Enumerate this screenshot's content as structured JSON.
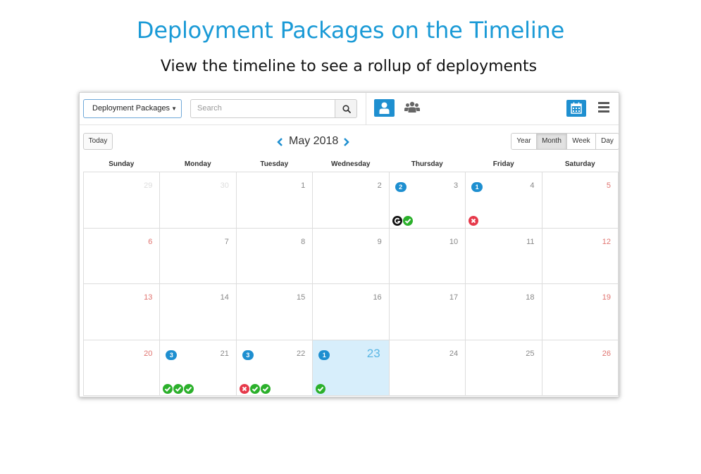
{
  "heading": {
    "title": "Deployment Packages on the Timeline",
    "subtitle": "View the timeline to see a rollup of deployments"
  },
  "toolbar": {
    "type_select": "Deployment Packages",
    "search_placeholder": "Search",
    "accent_color": "#1e8fd0"
  },
  "nav": {
    "today_label": "Today",
    "month_label": "May 2018",
    "views": [
      "Year",
      "Month",
      "Week",
      "Day"
    ],
    "active_view": "Month"
  },
  "calendar": {
    "weekdays": [
      "Sunday",
      "Monday",
      "Tuesday",
      "Wednesday",
      "Thursday",
      "Friday",
      "Saturday"
    ],
    "weeks": [
      [
        {
          "num": "29",
          "kind": "other"
        },
        {
          "num": "30",
          "kind": "other"
        },
        {
          "num": "1"
        },
        {
          "num": "2"
        },
        {
          "num": "3",
          "count": "2",
          "statuses": [
            "g",
            "ok"
          ]
        },
        {
          "num": "4",
          "count": "1",
          "statuses": [
            "fail"
          ]
        },
        {
          "num": "5",
          "kind": "weekend"
        }
      ],
      [
        {
          "num": "6",
          "kind": "weekend"
        },
        {
          "num": "7"
        },
        {
          "num": "8"
        },
        {
          "num": "9"
        },
        {
          "num": "10"
        },
        {
          "num": "11"
        },
        {
          "num": "12",
          "kind": "weekend"
        }
      ],
      [
        {
          "num": "13",
          "kind": "weekend"
        },
        {
          "num": "14"
        },
        {
          "num": "15"
        },
        {
          "num": "16"
        },
        {
          "num": "17"
        },
        {
          "num": "18"
        },
        {
          "num": "19",
          "kind": "weekend"
        }
      ],
      [
        {
          "num": "20",
          "kind": "weekend"
        },
        {
          "num": "21",
          "count": "3",
          "statuses": [
            "ok",
            "ok",
            "ok"
          ]
        },
        {
          "num": "22",
          "count": "3",
          "statuses": [
            "fail",
            "ok",
            "ok"
          ]
        },
        {
          "num": "23",
          "kind": "today",
          "count": "1",
          "statuses": [
            "ok"
          ]
        },
        {
          "num": "24"
        },
        {
          "num": "25"
        },
        {
          "num": "26",
          "kind": "weekend"
        }
      ]
    ]
  }
}
